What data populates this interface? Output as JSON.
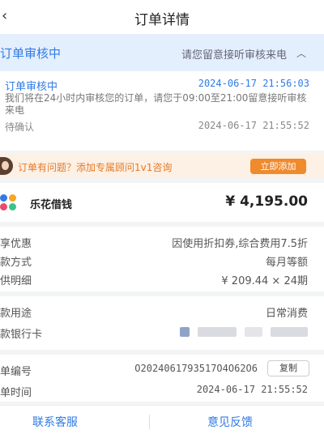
{
  "nav": {
    "back_icon": "‹",
    "title": "订单详情"
  },
  "banner": {
    "status": "订单审核中",
    "tip": "请您留意接听审核来电",
    "arrow": "︿"
  },
  "timeline": {
    "status": "订单审核中",
    "time1": "2024-06-17 21:56:03",
    "desc": "我们将在24小时内审核您的订单，请您于09:00至21:00留意接听审核来电",
    "wait": "待确认",
    "time2": "2024-06-17 21:55:52"
  },
  "promo": {
    "text": "订单有问题？添加专属顾问1v1咨询",
    "button": "立即添加"
  },
  "lender": {
    "name": "乐花借钱",
    "amount": "¥ 4,195.00",
    "logo_colors": [
      "#2f7be6",
      "#f5a623",
      "#e94b6b",
      "#3cc28a"
    ]
  },
  "details": {
    "discount_label": "享优惠",
    "discount_value": "因使用折扣券,综合费用7.5折",
    "repay_label": "款方式",
    "repay_value": "每月等额",
    "detail_label": "供明细",
    "detail_value": "¥ 209.44 × 24期"
  },
  "usage": {
    "purpose_label": "款用途",
    "purpose_value": "日常消费",
    "card_label": "款银行卡"
  },
  "order": {
    "no_label": "单编号",
    "no_value": "O2024061793517O4O62O6",
    "copy": "复制",
    "time_label": "单时间",
    "time_value": "2024-06-17 21:55:52"
  },
  "footer": {
    "service": "联系客服",
    "feedback": "意见反馈"
  }
}
